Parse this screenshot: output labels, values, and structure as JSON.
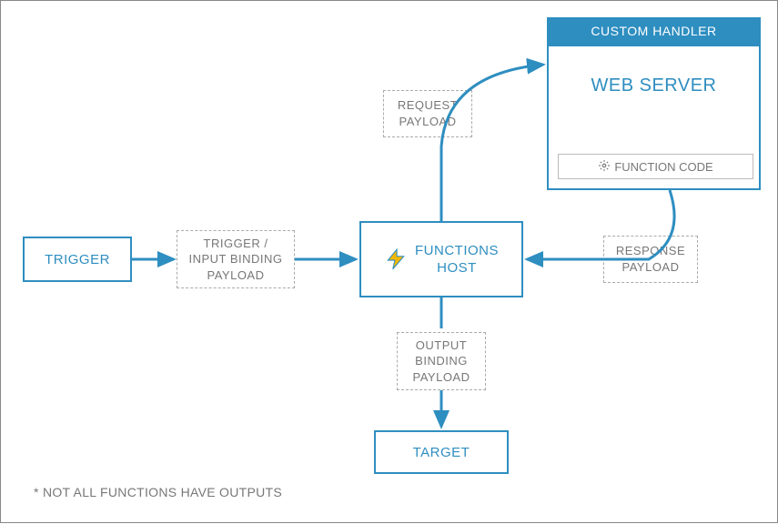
{
  "nodes": {
    "trigger": "TRIGGER",
    "trigger_payload": "TRIGGER /\nINPUT BINDING\nPAYLOAD",
    "functions_host": "FUNCTIONS\nHOST",
    "request_payload": "REQUEST\nPAYLOAD",
    "response_payload": "RESPONSE\nPAYLOAD",
    "output_payload": "OUTPUT\nBINDING\nPAYLOAD",
    "target": "TARGET",
    "custom_handler_header": "CUSTOM HANDLER",
    "web_server": "WEB SERVER",
    "function_code": "FUNCTION CODE"
  },
  "footnote": "* NOT ALL FUNCTIONS HAVE OUTPUTS",
  "colors": {
    "accent": "#2e8ec0",
    "border_gray": "#888",
    "text_gray": "#777"
  },
  "flow": [
    {
      "from": "trigger",
      "to": "functions_host",
      "via": "trigger_input_binding_payload"
    },
    {
      "from": "functions_host",
      "to": "web_server",
      "via": "request_payload"
    },
    {
      "from": "web_server",
      "to": "functions_host",
      "via": "response_payload"
    },
    {
      "from": "functions_host",
      "to": "target",
      "via": "output_binding_payload"
    }
  ]
}
